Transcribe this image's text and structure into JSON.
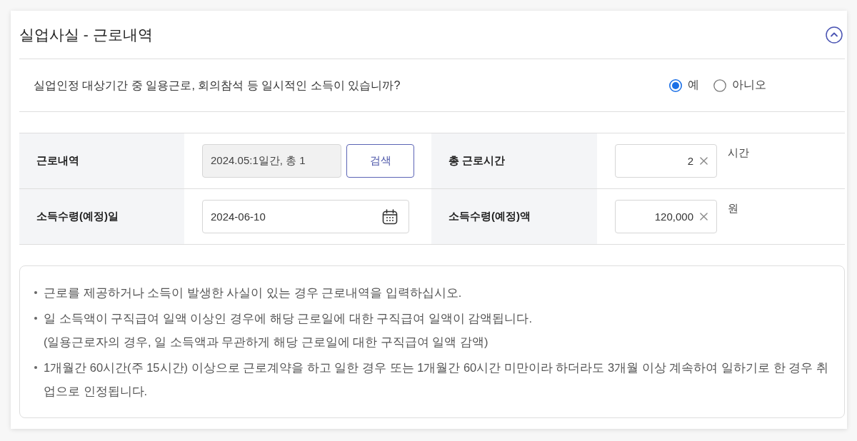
{
  "section": {
    "title": "실업사실 - 근로내역",
    "expanded": true
  },
  "question": {
    "text": "실업인정 대상기간 중 일용근로, 회의참석 등 일시적인 소득이 있습니까?",
    "options": [
      {
        "label": "예",
        "selected": true
      },
      {
        "label": "아니오",
        "selected": false
      }
    ]
  },
  "fields": [
    {
      "label": "근로내역",
      "kind": "search",
      "value": "2024.05:1일간, 총 1",
      "disabled": true,
      "button": "검색"
    },
    {
      "label": "총 근로시간",
      "kind": "number",
      "value": "2",
      "unit": "시간",
      "disabled": false
    },
    {
      "label": "소득수령(예정)일",
      "kind": "date",
      "value": "2024-06-10",
      "disabled": false
    },
    {
      "label": "소득수령(예정)액",
      "kind": "number",
      "value": "120,000",
      "unit": "원",
      "disabled": false
    }
  ],
  "notes": [
    {
      "lines": [
        "근로를 제공하거나 소득이 발생한 사실이 있는 경우 근로내역을 입력하십시오."
      ]
    },
    {
      "lines": [
        "일 소득액이 구직급여 일액 이상인 경우에 해당 근로일에 대한 구직급여 일액이 감액됩니다.",
        "(일용근로자의 경우, 일 소득액과 무관하게 해당 근로일에 대한 구직급여 일액 감액)"
      ]
    },
    {
      "lines": [
        "1개월간 60시간(주 15시간) 이상으로 근로계약을 하고 일한 경우 또는 1개월간 60시간 미만이라 하더라도 3개월 이상 계속하여 일하기로 한 경우 취업으로 인정됩니다."
      ]
    }
  ]
}
